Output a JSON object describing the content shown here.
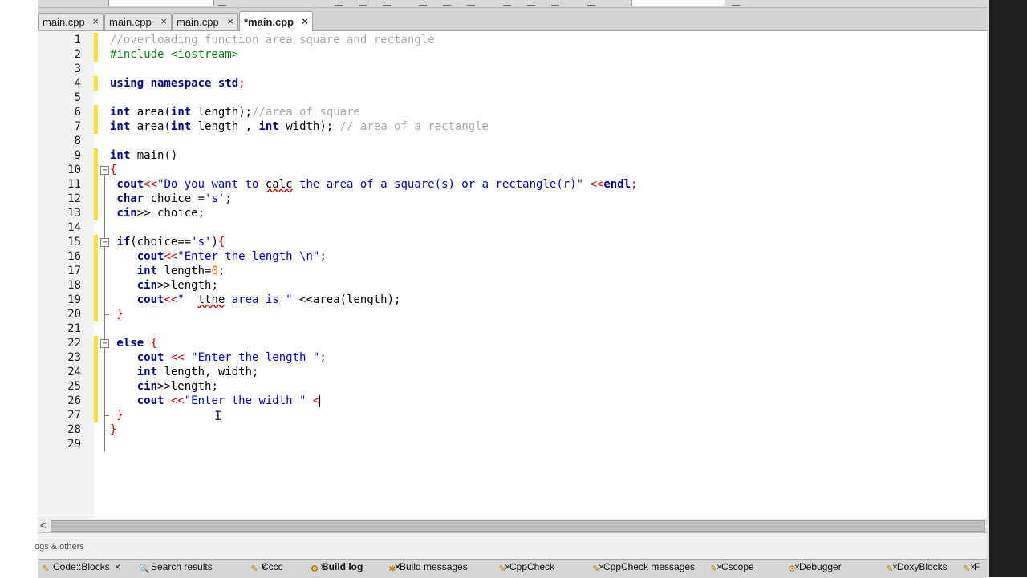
{
  "tabs": [
    {
      "label": "main.cpp",
      "close": "×",
      "active": false
    },
    {
      "label": "main.cpp",
      "close": "×",
      "active": false
    },
    {
      "label": "main.cpp",
      "close": "×",
      "active": false
    },
    {
      "label": "*main.cpp",
      "close": "×",
      "active": true
    }
  ],
  "code_lines": [
    {
      "num": "1",
      "tokens": [
        {
          "t": "//overloading function area square and rectangle",
          "c": "cmt"
        }
      ]
    },
    {
      "num": "2",
      "tokens": [
        {
          "t": "#include <iostream>",
          "c": "pp"
        }
      ]
    },
    {
      "num": "3",
      "tokens": []
    },
    {
      "num": "4",
      "tokens": [
        {
          "t": "using namespace std",
          "c": "kw"
        },
        {
          "t": ";",
          "c": "op"
        }
      ]
    },
    {
      "num": "5",
      "tokens": []
    },
    {
      "num": "6",
      "tokens": [
        {
          "t": "int",
          "c": "kw"
        },
        {
          "t": " area",
          "c": "normal"
        },
        {
          "t": "(",
          "c": "normal"
        },
        {
          "t": "int",
          "c": "kw"
        },
        {
          "t": " length",
          "c": "normal"
        },
        {
          "t": ");",
          "c": "normal"
        },
        {
          "t": "//area of square",
          "c": "cmt"
        }
      ]
    },
    {
      "num": "7",
      "tokens": [
        {
          "t": "int",
          "c": "kw"
        },
        {
          "t": " area",
          "c": "normal"
        },
        {
          "t": "(",
          "c": "normal"
        },
        {
          "t": "int",
          "c": "kw"
        },
        {
          "t": " length , ",
          "c": "normal"
        },
        {
          "t": "int",
          "c": "kw"
        },
        {
          "t": " width); ",
          "c": "normal"
        },
        {
          "t": "// area of a rectangle",
          "c": "cmt"
        }
      ]
    },
    {
      "num": "8",
      "tokens": []
    },
    {
      "num": "9",
      "tokens": [
        {
          "t": "int",
          "c": "kw"
        },
        {
          "t": " main()",
          "c": "normal"
        }
      ]
    },
    {
      "num": "10",
      "tokens": [
        {
          "t": "{",
          "c": "op"
        }
      ]
    },
    {
      "num": "11",
      "tokens": [
        {
          "t": " cout",
          "c": "kw"
        },
        {
          "t": "<<",
          "c": "op"
        },
        {
          "t": "\"Do you want to ",
          "c": "str"
        },
        {
          "t": "calc",
          "c": "bad"
        },
        {
          "t": " the area of a square(s) or a rectangle(r)\"",
          "c": "str"
        },
        {
          "t": " <<",
          "c": "op"
        },
        {
          "t": "endl",
          "c": "kw"
        },
        {
          "t": ";",
          "c": "op"
        }
      ]
    },
    {
      "num": "12",
      "tokens": [
        {
          "t": " char",
          "c": "kw"
        },
        {
          "t": " choice =",
          "c": "normal"
        },
        {
          "t": "'s'",
          "c": "str"
        },
        {
          "t": ";",
          "c": "normal"
        }
      ]
    },
    {
      "num": "13",
      "tokens": [
        {
          "t": " cin",
          "c": "kw"
        },
        {
          "t": ">>",
          "c": "normal"
        },
        {
          "t": " choice;",
          "c": "normal"
        }
      ]
    },
    {
      "num": "14",
      "tokens": []
    },
    {
      "num": "15",
      "tokens": [
        {
          "t": " if",
          "c": "kw"
        },
        {
          "t": "(choice==",
          "c": "normal"
        },
        {
          "t": "'s'",
          "c": "str"
        },
        {
          "t": ")",
          "c": "normal"
        },
        {
          "t": "{",
          "c": "op"
        }
      ]
    },
    {
      "num": "16",
      "tokens": [
        {
          "t": "    cout",
          "c": "kw"
        },
        {
          "t": "<<",
          "c": "op"
        },
        {
          "t": "\"Enter the length \\n\"",
          "c": "str"
        },
        {
          "t": ";",
          "c": "normal"
        }
      ]
    },
    {
      "num": "17",
      "tokens": [
        {
          "t": "    int",
          "c": "kw"
        },
        {
          "t": " length=",
          "c": "normal"
        },
        {
          "t": "0",
          "c": "num"
        },
        {
          "t": ";",
          "c": "normal"
        }
      ]
    },
    {
      "num": "18",
      "tokens": [
        {
          "t": "    cin",
          "c": "kw"
        },
        {
          "t": ">>length;",
          "c": "normal"
        }
      ]
    },
    {
      "num": "19",
      "tokens": [
        {
          "t": "    cout",
          "c": "kw"
        },
        {
          "t": "<<",
          "c": "op"
        },
        {
          "t": "\"  ",
          "c": "str"
        },
        {
          "t": "tthe",
          "c": "bad"
        },
        {
          "t": " area is \"",
          "c": "str"
        },
        {
          "t": " <<area(length);",
          "c": "normal"
        }
      ]
    },
    {
      "num": "20",
      "tokens": [
        {
          "t": " }",
          "c": "op"
        }
      ]
    },
    {
      "num": "21",
      "tokens": []
    },
    {
      "num": "22",
      "tokens": [
        {
          "t": " else",
          "c": "kw"
        },
        {
          "t": " {",
          "c": "op"
        }
      ]
    },
    {
      "num": "23",
      "tokens": [
        {
          "t": "    cout",
          "c": "kw"
        },
        {
          "t": " << ",
          "c": "op"
        },
        {
          "t": "\"Enter the length \"",
          "c": "str"
        },
        {
          "t": ";",
          "c": "normal"
        }
      ]
    },
    {
      "num": "24",
      "tokens": [
        {
          "t": "    int",
          "c": "kw"
        },
        {
          "t": " length, width;",
          "c": "normal"
        }
      ]
    },
    {
      "num": "25",
      "tokens": [
        {
          "t": "    cin",
          "c": "kw"
        },
        {
          "t": ">>length;",
          "c": "normal"
        }
      ]
    },
    {
      "num": "26",
      "tokens": [
        {
          "t": "    cout",
          "c": "kw"
        },
        {
          "t": " <<",
          "c": "op"
        },
        {
          "t": "\"Enter the width \"",
          "c": "str"
        },
        {
          "t": " <",
          "c": "op"
        }
      ]
    },
    {
      "num": "27",
      "tokens": [
        {
          "t": " }",
          "c": "op"
        }
      ]
    },
    {
      "num": "28",
      "tokens": [
        {
          "t": "}",
          "c": "op"
        }
      ]
    },
    {
      "num": "29",
      "tokens": []
    }
  ],
  "changed_lines": [
    "1",
    "2",
    "4",
    "6",
    "7",
    "9",
    "10",
    "11",
    "12",
    "13",
    "15",
    "16",
    "17",
    "18",
    "19",
    "20",
    "22",
    "23",
    "24",
    "25",
    "26",
    "27"
  ],
  "fold_markers": [
    "10",
    "15",
    "22"
  ],
  "hscroll": {
    "left_arrow": "<"
  },
  "panel": {
    "label": "ogs & others"
  },
  "bottom_tabs": [
    {
      "label": "Code::Blocks",
      "icon": "codeblocks-icon",
      "glyph": "✎",
      "close": "×",
      "active": false
    },
    {
      "label": "Search results",
      "icon": "search-icon",
      "glyph": "🔍",
      "close": "×",
      "active": false
    },
    {
      "label": "Cccc",
      "icon": "cccc-icon",
      "glyph": "✎",
      "close": "×",
      "active": false
    },
    {
      "label": "Build log",
      "icon": "gear-icon",
      "glyph": "⚙",
      "close": "×",
      "active": true
    },
    {
      "label": "Build messages",
      "icon": "pin-icon",
      "glyph": "✱",
      "close": "×",
      "active": false
    },
    {
      "label": "CppCheck",
      "icon": "cppcheck-icon",
      "glyph": "✎",
      "close": "×",
      "active": false
    },
    {
      "label": "CppCheck messages",
      "icon": "cppcheck-messages-icon",
      "glyph": "✎",
      "close": "×",
      "active": false
    },
    {
      "label": "Cscope",
      "icon": "cscope-icon",
      "glyph": "✎",
      "close": "×",
      "active": false
    },
    {
      "label": "Debugger",
      "icon": "debugger-icon",
      "glyph": "⚙",
      "close": "×",
      "active": false
    },
    {
      "label": "DoxyBlocks",
      "icon": "doxyblocks-icon",
      "glyph": "✎",
      "close": "×",
      "active": false
    },
    {
      "label": "F",
      "icon": "f-icon",
      "glyph": "✎",
      "close": "",
      "active": false
    }
  ],
  "colors": {
    "change_marker": "#f5e03c",
    "keyword": "#00008b",
    "string": "#0000c0",
    "comment": "#a8a8a8",
    "operator": "#c00000"
  }
}
